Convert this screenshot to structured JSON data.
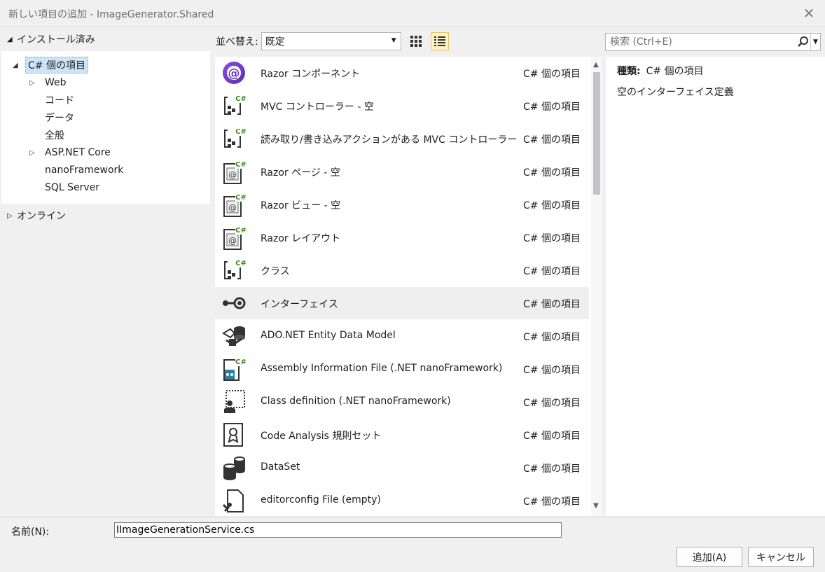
{
  "window": {
    "title": "新しい項目の追加 - ImageGenerator.Shared"
  },
  "left": {
    "installed_label": "インストール済み",
    "online_label": "オンライン",
    "tree": [
      {
        "label": "C# 個の項目",
        "level": 0,
        "expander": "open"
      },
      {
        "label": "Web",
        "level": 1,
        "expander": "closed"
      },
      {
        "label": "コード",
        "level": 1,
        "expander": "none"
      },
      {
        "label": "データ",
        "level": 1,
        "expander": "none"
      },
      {
        "label": "全般",
        "level": 1,
        "expander": "none"
      },
      {
        "label": "ASP.NET Core",
        "level": 1,
        "expander": "closed"
      },
      {
        "label": "nanoFramework",
        "level": 1,
        "expander": "none"
      },
      {
        "label": "SQL Server",
        "level": 1,
        "expander": "none"
      }
    ]
  },
  "sort": {
    "label": "並べ替え:",
    "value": "既定"
  },
  "search": {
    "placeholder": "検索 (Ctrl+E)"
  },
  "templates": [
    {
      "name": "Razor コンポーネント",
      "category": "C# 個の項目",
      "icon": "blazor-component-icon"
    },
    {
      "name": "MVC コントローラー - 空",
      "category": "C# 個の項目",
      "icon": "csharp-class-icon"
    },
    {
      "name": "読み取り/書き込みアクションがある MVC コントローラー",
      "category": "C# 個の項目",
      "icon": "csharp-class-icon"
    },
    {
      "name": "Razor ページ - 空",
      "category": "C# 個の項目",
      "icon": "razor-page-icon"
    },
    {
      "name": "Razor ビュー - 空",
      "category": "C# 個の項目",
      "icon": "razor-page-icon"
    },
    {
      "name": "Razor レイアウト",
      "category": "C# 個の項目",
      "icon": "razor-page-icon"
    },
    {
      "name": "クラス",
      "category": "C# 個の項目",
      "icon": "csharp-class-icon"
    },
    {
      "name": "インターフェイス",
      "category": "C# 個の項目",
      "icon": "interface-icon"
    },
    {
      "name": "ADO.NET Entity Data Model",
      "category": "C# 個の項目",
      "icon": "entity-model-icon"
    },
    {
      "name": "Assembly Information File (.NET nanoFramework)",
      "category": "C# 個の項目",
      "icon": "assembly-info-icon"
    },
    {
      "name": "Class definition (.NET nanoFramework)",
      "category": "C# 個の項目",
      "icon": "class-definition-icon"
    },
    {
      "name": "Code Analysis 規則セット",
      "category": "C# 個の項目",
      "icon": "ruleset-icon"
    },
    {
      "name": "DataSet",
      "category": "C# 個の項目",
      "icon": "dataset-icon"
    },
    {
      "name": "editorconfig File (empty)",
      "category": "C# 個の項目",
      "icon": "editorconfig-icon"
    }
  ],
  "selected_index": 7,
  "details": {
    "type_label": "種類:",
    "type_value": "C# 個の項目",
    "description": "空のインターフェイス定義"
  },
  "bottom": {
    "name_label": "名前(N):",
    "name_value": "IImageGenerationService.cs",
    "add_label": "追加(A)",
    "cancel_label": "キャンセル"
  }
}
